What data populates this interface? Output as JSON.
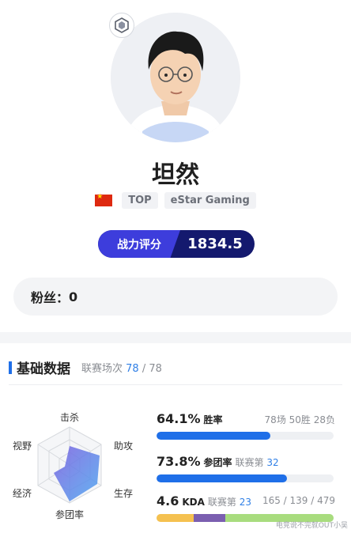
{
  "player": {
    "name": "坦然",
    "position": "TOP",
    "team": "eStar Gaming",
    "flag": "cn-flag-icon"
  },
  "score": {
    "label": "战力评分",
    "value": "1834.5"
  },
  "fans": {
    "label": "粉丝：",
    "value": "0"
  },
  "basic_stats": {
    "title": "基础数据",
    "matches_label": "联赛场次",
    "matches_played": "78",
    "matches_sep": "/",
    "matches_total": "78",
    "win_rate": {
      "value": "64.1%",
      "label": "胜率",
      "detail": "78场 50胜 28负",
      "fraction": 0.641
    },
    "kp": {
      "value": "73.8%",
      "label": "参团率",
      "rank_label": "联赛第",
      "rank": "32",
      "fraction": 0.738
    },
    "kda": {
      "value": "4.6",
      "label": "KDA",
      "rank_label": "联赛第",
      "rank": "23",
      "detail": "165 / 139 / 479",
      "kills": 165,
      "deaths": 139,
      "assists": 479
    },
    "radar": {
      "labels": {
        "top": "击杀",
        "upper_right": "助攻",
        "lower_right": "生存",
        "bottom": "参团率",
        "lower_left": "经济",
        "upper_left": "视野"
      }
    }
  },
  "watermark": "电竞说不完就OUT小吴",
  "colors": {
    "accent": "#1f6fe8",
    "score_bg": "#14196e",
    "score_label": "#3d3ddc",
    "kills": "#f5c150",
    "deaths": "#7b5fb0",
    "assists": "#a8dc7e"
  }
}
